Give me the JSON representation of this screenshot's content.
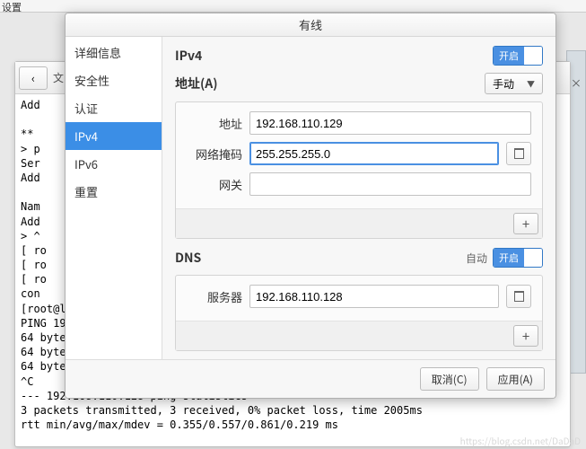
{
  "top_panel": "设置",
  "dialog": {
    "title": "有线",
    "sidebar": [
      "详细信息",
      "安全性",
      "认证",
      "IPv4",
      "IPv6",
      "重置"
    ],
    "selected_index": 3,
    "ipv4": {
      "header": "IPv4",
      "toggle_on": "开启",
      "address_header": "地址(A)",
      "method_select": "手动",
      "label_address": "地址",
      "label_netmask": "网络掩码",
      "label_gateway": "网关",
      "value_address": "192.168.110.129",
      "value_netmask": "255.255.255.0",
      "value_gateway": ""
    },
    "dns": {
      "header": "DNS",
      "auto_label": "自动",
      "toggle_on": "开启",
      "label_server": "服务器",
      "value_server": "192.168.110.128"
    },
    "footer": {
      "cancel": "取消(C)",
      "apply": "应用(A)"
    }
  },
  "terminal": {
    "tab": "文",
    "body": "Add\n\n**\n> p\nSer\nAdd\n\nNam\nAdd\n> ^\n[ ro\n[ ro\n[ ro\ncon\n[root@l\nPING 19\n64 byte\n64 byte\n64 byte\n^C\n--- 192.168.110.128 ping statistics ---\n3 packets transmitted, 3 received, 0% packet loss, time 2005ms\nrtt min/avg/max/mdev = 0.355/0.557/0.861/0.219 ms"
  },
  "watermark": "https://blog.csdn.net/DaDaD"
}
